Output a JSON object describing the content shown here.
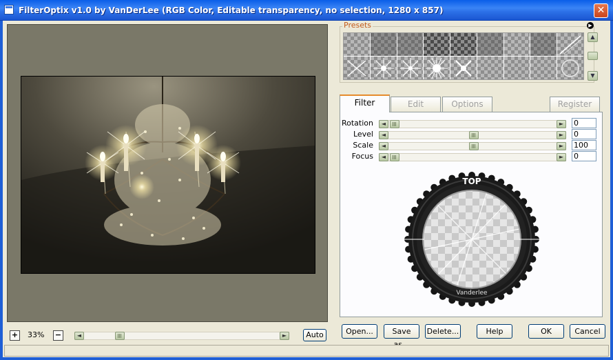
{
  "window": {
    "title": "FilterOptix v1.0 by VanDerLee (RGB Color, Editable transparency, no selection, 1280 x 857)",
    "close_label": "✕"
  },
  "preview": {
    "zoom_in_label": "+",
    "zoom_out_label": "−",
    "zoom_value": "33%",
    "auto_label": "Auto",
    "scroll_left_label": "◄",
    "scroll_right_label": "►"
  },
  "presets": {
    "label": "Presets",
    "menu_icon": "arrow-right-circle-icon",
    "scroll_up_label": "▲",
    "scroll_down_label": "▼"
  },
  "tabs": [
    {
      "label": "Filter",
      "active": true
    },
    {
      "label": "Edit",
      "active": false
    },
    {
      "label": "Options",
      "active": false
    },
    {
      "label": "Register",
      "active": false
    }
  ],
  "params": [
    {
      "label": "Rotation",
      "value": "0",
      "position": 0.0
    },
    {
      "label": "Level",
      "value": "0",
      "position": 0.5
    },
    {
      "label": "Scale",
      "value": "100",
      "position": 0.5
    },
    {
      "label": "Focus",
      "value": "0",
      "position": 0.0
    }
  ],
  "dial": {
    "top_label": "TOP",
    "brand_label": "Vanderlee"
  },
  "buttons": {
    "open": "Open...",
    "save_as": "Save as...",
    "delete": "Delete...",
    "help": "Help",
    "ok": "OK",
    "cancel": "Cancel"
  },
  "colors": {
    "titlebar": "#2b6fe6",
    "presets_label": "#c25a1b",
    "active_tab_accent": "#e68b2c"
  }
}
